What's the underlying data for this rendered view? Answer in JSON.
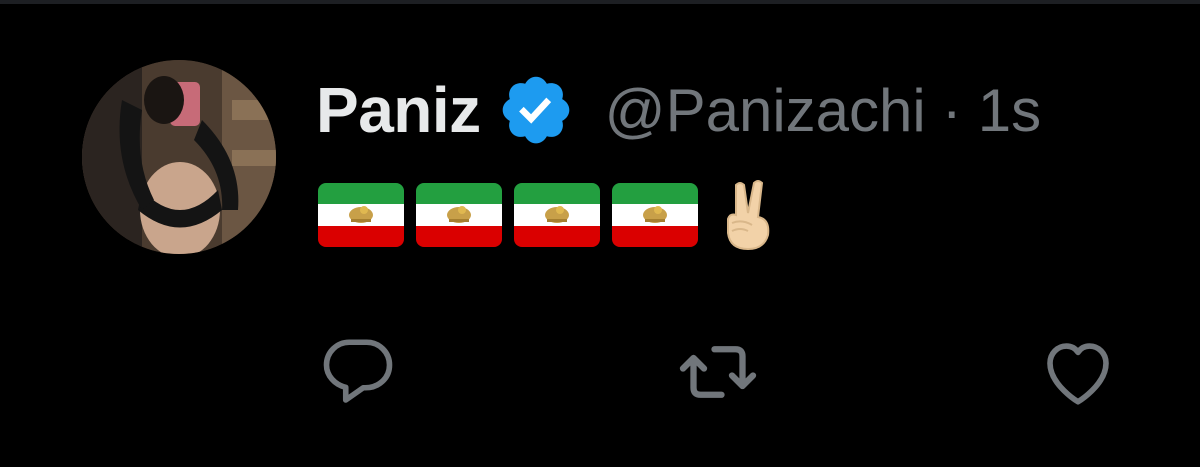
{
  "tweet": {
    "author": {
      "display_name": "Paniz",
      "handle": "@Panizachi",
      "verified": true,
      "avatar_icon": "profile-photo"
    },
    "separator": "·",
    "timestamp": "1s",
    "content": {
      "emojis": [
        "iran-lion-and-sun-flag",
        "iran-lion-and-sun-flag",
        "iran-lion-and-sun-flag",
        "iran-lion-and-sun-flag",
        "victory-hand-light-skin-tone"
      ]
    },
    "actions": {
      "reply_icon": "speech-bubble-icon",
      "retweet_icon": "retweet-arrows-icon",
      "like_icon": "heart-icon"
    }
  },
  "colors": {
    "background": "#000000",
    "name_text": "#e7e9ea",
    "secondary_text": "#71767b",
    "verified_blue": "#1d9bf0",
    "flag_green": "#239f40",
    "flag_white": "#ffffff",
    "flag_red": "#da0000",
    "emblem_gold": "#c8a049"
  }
}
